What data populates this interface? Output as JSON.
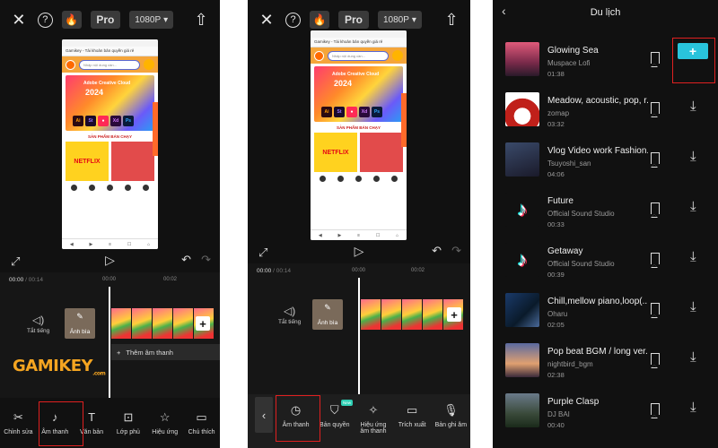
{
  "panel1": {
    "topbar": {
      "close_icon": "close-icon",
      "help_icon": "help-icon",
      "pro_label": "Pro",
      "resolution": "1080P"
    },
    "preview": {
      "url_text": "Gamikey - Tài khoản bản quyền giá rẻ",
      "search_placeholder": "Nhập nội dung cần...",
      "banner_title": "Adobe Creative Cloud",
      "banner_year": "2024",
      "section_title": "SẢN PHẨM BÁN CHẠY",
      "product1": "NETFLIX"
    },
    "timeline": {
      "current": "00:00",
      "total": "00:14",
      "tick1": "00:00",
      "tick2": "00:02",
      "audio_label": "Tắt tiếng",
      "cover_label": "Ảnh bìa",
      "add_audio": "Thêm âm thanh"
    },
    "watermark": "GAMIKEY",
    "watermark_suffix": ".com",
    "toolbar": [
      {
        "icon": "scissors-icon",
        "label": "Chỉnh sửa"
      },
      {
        "icon": "music-note-icon",
        "label": "Âm thanh"
      },
      {
        "icon": "text-icon",
        "label": "Văn bản"
      },
      {
        "icon": "layer-icon",
        "label": "Lớp phủ"
      },
      {
        "icon": "effects-icon",
        "label": "Hiệu ứng"
      },
      {
        "icon": "caption-icon",
        "label": "Chú thích"
      }
    ]
  },
  "panel2": {
    "topbar": {
      "pro_label": "Pro",
      "resolution": "1080P"
    },
    "preview": {
      "url_text": "Gamikey - Tài khoản bản quyền giá rẻ",
      "search_placeholder": "Nhập nội dung cần...",
      "banner_title": "Adobe Creative Cloud",
      "banner_year": "2024",
      "section_title": "SẢN PHẨM BÁN CHẠY",
      "product1": "NETFLIX"
    },
    "timeline": {
      "current": "00:00",
      "total": "00:14",
      "tick1": "00:00",
      "tick2": "00:02",
      "audio_label": "Tắt tiếng",
      "cover_label": "Ảnh bìa"
    },
    "new_badge": "New",
    "toolbar": [
      {
        "icon": "tiktok-sound-icon",
        "label": "Âm thanh"
      },
      {
        "icon": "shield-icon",
        "label": "Bản quyền"
      },
      {
        "icon": "sparkle-icon",
        "label": "Hiệu ứng âm thanh"
      },
      {
        "icon": "folder-icon",
        "label": "Trích xuất"
      },
      {
        "icon": "mic-icon",
        "label": "Bản ghi âm"
      }
    ]
  },
  "panel3": {
    "title": "Du lịch",
    "tracks": [
      {
        "name": "Glowing Sea",
        "artist": "Muspace Lofi",
        "duration": "01:38",
        "action": "add"
      },
      {
        "name": "Meadow, acoustic, pop, r...",
        "artist": "zomap",
        "duration": "03:32",
        "action": "download"
      },
      {
        "name": "Vlog Video work Fashion...",
        "artist": "Tsuyoshi_san",
        "duration": "04:06",
        "action": "download"
      },
      {
        "name": "Future",
        "artist": "Official Sound Studio",
        "duration": "00:33",
        "action": "download"
      },
      {
        "name": "Getaway",
        "artist": "Official Sound Studio",
        "duration": "00:39",
        "action": "download"
      },
      {
        "name": "Chill,mellow piano,loop(...",
        "artist": "Oharu",
        "duration": "02:05",
        "action": "download"
      },
      {
        "name": "Pop beat BGM / long ver...",
        "artist": "nightbird_bgm",
        "duration": "02:38",
        "action": "download"
      },
      {
        "name": "Purple Clasp",
        "artist": "DJ BAI",
        "duration": "00:40",
        "action": "download"
      }
    ],
    "add_label": "+"
  }
}
